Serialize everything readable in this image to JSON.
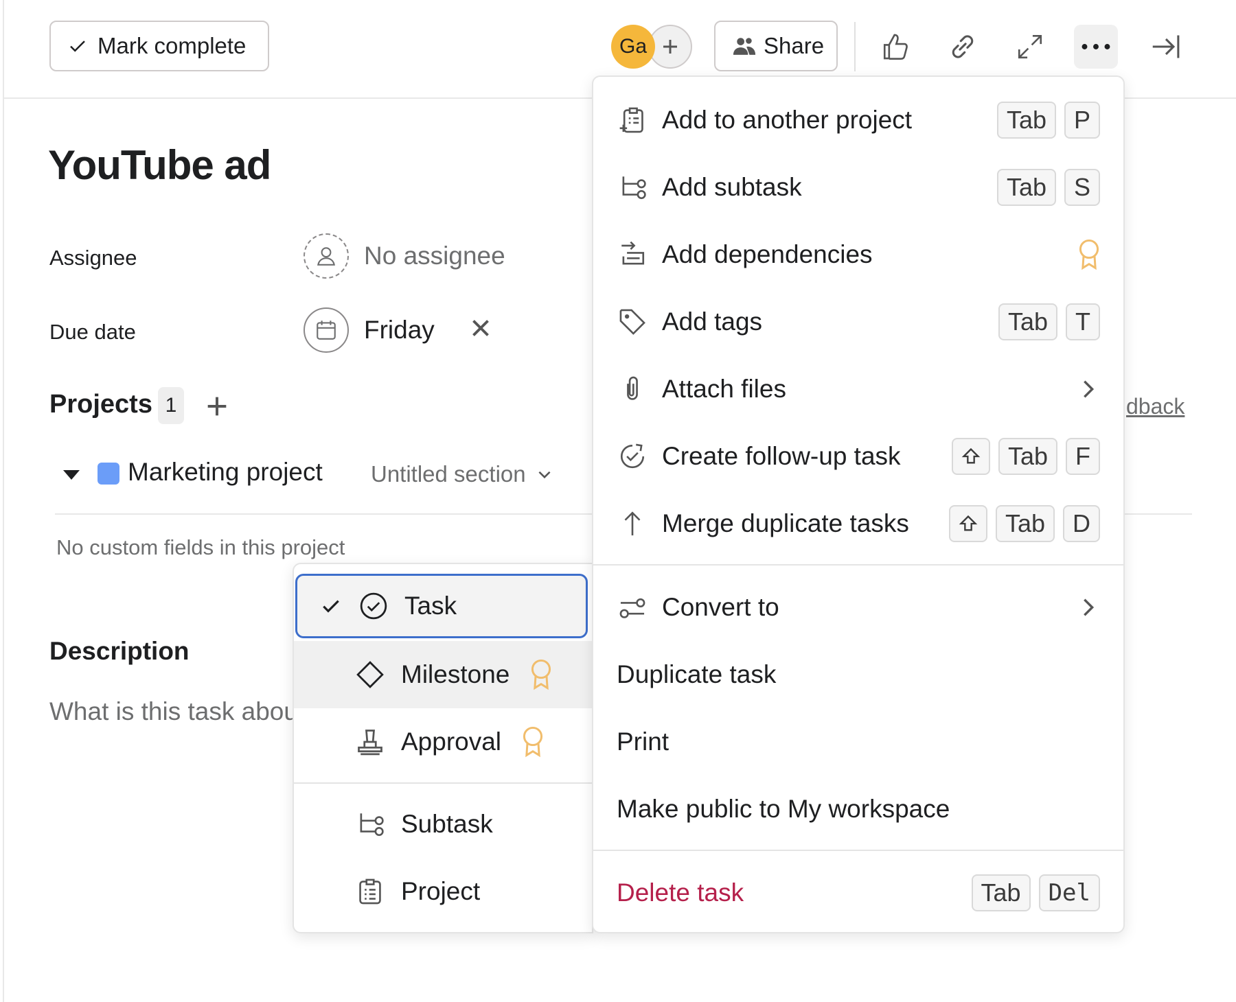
{
  "toolbar": {
    "mark_complete_label": "Mark complete",
    "avatar_initials": "Ga",
    "share_label": "Share",
    "icons": [
      "thumbs-up-icon",
      "link-icon",
      "expand-icon",
      "more-icon",
      "close-panel-icon"
    ]
  },
  "task": {
    "title": "YouTube ad",
    "assignee_label": "Assignee",
    "assignee_value": "No assignee",
    "due_date_label": "Due date",
    "due_date_value": "Friday",
    "projects_label": "Projects",
    "projects_count": "1",
    "project_name": "Marketing project",
    "project_color": "#6b9df8",
    "project_section": "Untitled section",
    "no_custom_fields": "No custom fields in this project",
    "feedback_fragment": "dback",
    "description_label": "Description",
    "description_placeholder": "What is this task about?"
  },
  "menu": {
    "items": [
      {
        "label": "Add to another project",
        "icon": "add-to-project-icon",
        "keys": [
          "Tab",
          "P"
        ]
      },
      {
        "label": "Add subtask",
        "icon": "subtask-icon",
        "keys": [
          "Tab",
          "S"
        ]
      },
      {
        "label": "Add dependencies",
        "icon": "dependencies-icon",
        "badge": "premium-badge-icon"
      },
      {
        "label": "Add tags",
        "icon": "tag-icon",
        "keys": [
          "Tab",
          "T"
        ]
      },
      {
        "label": "Attach files",
        "icon": "paperclip-icon",
        "submenu": true
      },
      {
        "label": "Create follow-up task",
        "icon": "follow-up-icon",
        "keys": [
          "⇧",
          "Tab",
          "F"
        ]
      },
      {
        "label": "Merge duplicate tasks",
        "icon": "merge-icon",
        "keys": [
          "⇧",
          "Tab",
          "D"
        ]
      },
      {
        "label": "Convert to",
        "icon": "convert-icon",
        "submenu": true
      },
      {
        "label": "Duplicate task"
      },
      {
        "label": "Print"
      },
      {
        "label": "Make public to My workspace"
      },
      {
        "label": "Delete task",
        "keys": [
          "Tab",
          "Del"
        ],
        "danger_color": "#b5204b"
      }
    ]
  },
  "convert_submenu": {
    "items": [
      {
        "label": "Task",
        "icon": "task-check-icon",
        "selected": true
      },
      {
        "label": "Milestone",
        "icon": "milestone-icon",
        "badge": "premium-badge-icon"
      },
      {
        "label": "Approval",
        "icon": "approval-icon",
        "badge": "premium-badge-icon"
      },
      {
        "label": "Subtask",
        "icon": "subtask-icon"
      },
      {
        "label": "Project",
        "icon": "project-icon"
      }
    ]
  },
  "colors": {
    "accent_border": "#3d6ecb",
    "premium_badge": "#f1bd6c",
    "avatar_bg": "#f5b73b",
    "danger": "#b5204b"
  }
}
